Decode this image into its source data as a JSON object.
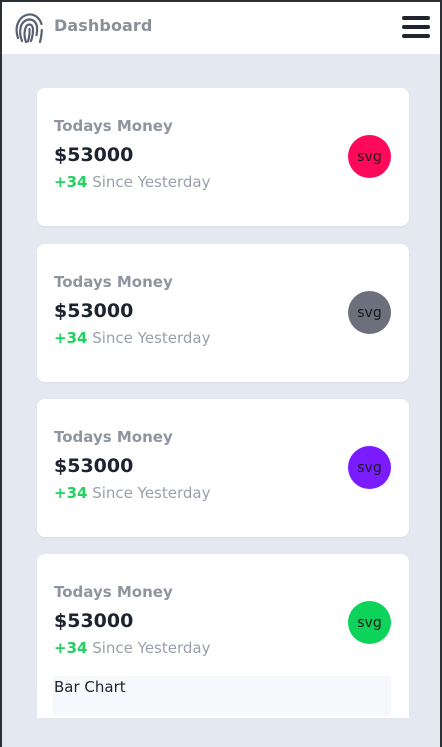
{
  "header": {
    "title": "Dashboard",
    "logo_icon": "fingerprint-icon",
    "menu_icon": "hamburger-menu-icon"
  },
  "cards": [
    {
      "title": "Todays Money",
      "value": "$53000",
      "delta": "+34",
      "since": " Since Yesterday",
      "icon_text": "svg",
      "icon_color": "#ff0a5a"
    },
    {
      "title": "Todays Money",
      "value": "$53000",
      "delta": "+34",
      "since": " Since Yesterday",
      "icon_text": "svg",
      "icon_color": "#6b707c"
    },
    {
      "title": "Todays Money",
      "value": "$53000",
      "delta": "+34",
      "since": " Since Yesterday",
      "icon_text": "svg",
      "icon_color": "#7a1cff"
    },
    {
      "title": "Todays Money",
      "value": "$53000",
      "delta": "+34",
      "since": " Since Yesterday",
      "icon_text": "svg",
      "icon_color": "#0ed35a"
    }
  ],
  "chart_section": {
    "title": "Bar Chart"
  },
  "colors": {
    "page_background": "#e4e8f0",
    "card_background": "#ffffff",
    "delta_positive": "#22d15f",
    "title_gray": "#8f959f",
    "value_dark": "#1e2330"
  }
}
